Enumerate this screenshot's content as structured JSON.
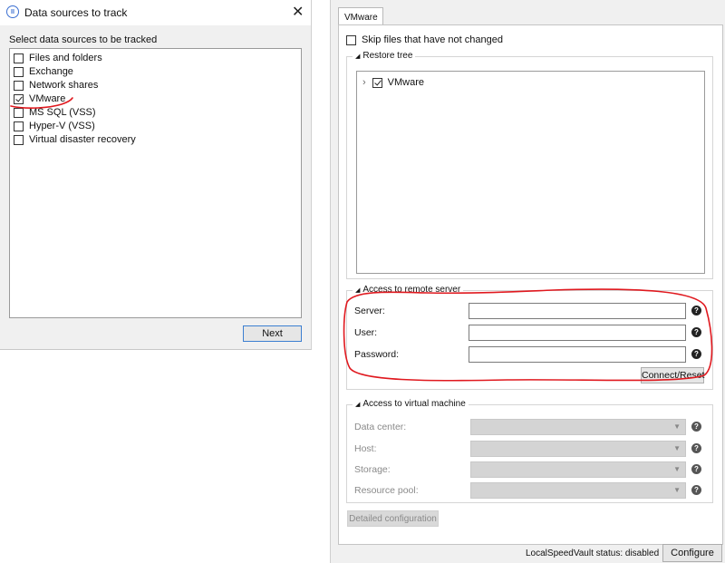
{
  "left_dialog": {
    "title": "Data sources to track",
    "select_label": "Select data sources to be tracked",
    "sources": [
      {
        "label": "Files and folders",
        "checked": false
      },
      {
        "label": "Exchange",
        "checked": false
      },
      {
        "label": "Network shares",
        "checked": false
      },
      {
        "label": "VMware",
        "checked": true
      },
      {
        "label": "MS SQL (VSS)",
        "checked": false
      },
      {
        "label": "Hyper-V (VSS)",
        "checked": false
      },
      {
        "label": "Virtual disaster recovery",
        "checked": false
      }
    ],
    "next_label": "Next"
  },
  "right_panel": {
    "tab_label": "VMware",
    "skip_label": "Skip files that have not changed",
    "restore_tree": {
      "title": "Restore tree",
      "node_label": "VMware",
      "node_checked": true
    },
    "remote_server": {
      "title": "Access to remote server",
      "server_label": "Server:",
      "user_label": "User:",
      "password_label": "Password:",
      "server_value": "",
      "user_value": "",
      "password_value": "",
      "connect_label": "Connect/Reset"
    },
    "virtual_machine": {
      "title": "Access to virtual machine",
      "datacenter_label": "Data center:",
      "host_label": "Host:",
      "storage_label": "Storage:",
      "resource_pool_label": "Resource pool:"
    },
    "detailed_config_label": "Detailed configuration",
    "status_text": "LocalSpeedVault status:  disabled",
    "configure_label": "Configure"
  },
  "colors": {
    "annotation": "#e0191f",
    "accent": "#3c7fd1"
  }
}
